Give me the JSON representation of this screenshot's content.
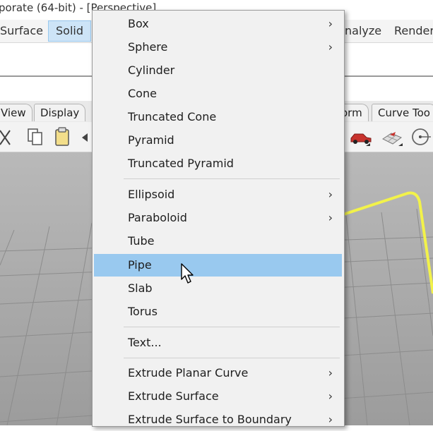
{
  "window": {
    "title": "porate (64-bit) - [Perspective]"
  },
  "menubar": {
    "surface": "Surface",
    "solid": "Solid",
    "analyze": "nalyze",
    "render": "Render"
  },
  "tabs": {
    "view": "View",
    "display": "Display",
    "transform": "orm",
    "curve_tools": "Curve Too"
  },
  "toolbar_icons": [
    "cut-icon",
    "copy-icon",
    "paste-icon",
    "car-icon",
    "grid-render-icon",
    "circle-target-icon"
  ],
  "solid_menu": {
    "items": [
      {
        "label": "Box",
        "submenu": true
      },
      {
        "label": "Sphere",
        "submenu": true
      },
      {
        "label": "Cylinder",
        "submenu": false
      },
      {
        "label": "Cone",
        "submenu": false
      },
      {
        "label": "Truncated Cone",
        "submenu": false
      },
      {
        "label": "Pyramid",
        "submenu": false
      },
      {
        "label": "Truncated Pyramid",
        "submenu": false
      },
      {
        "label": "Ellipsoid",
        "submenu": true
      },
      {
        "label": "Paraboloid",
        "submenu": true
      },
      {
        "label": "Tube",
        "submenu": false
      },
      {
        "label": "Pipe",
        "submenu": false,
        "highlighted": true
      },
      {
        "label": "Slab",
        "submenu": false
      },
      {
        "label": "Torus",
        "submenu": false
      },
      {
        "label": "Text...",
        "submenu": false
      },
      {
        "label": "Extrude Planar Curve",
        "submenu": true
      },
      {
        "label": "Extrude Surface",
        "submenu": true
      },
      {
        "label": "Extrude Surface to Boundary",
        "submenu": true
      }
    ],
    "submenu_arrow": "›"
  },
  "colors": {
    "highlight": "#99c9ef",
    "curve": "#f2f24a",
    "menu_bg": "#f1f1f1"
  }
}
